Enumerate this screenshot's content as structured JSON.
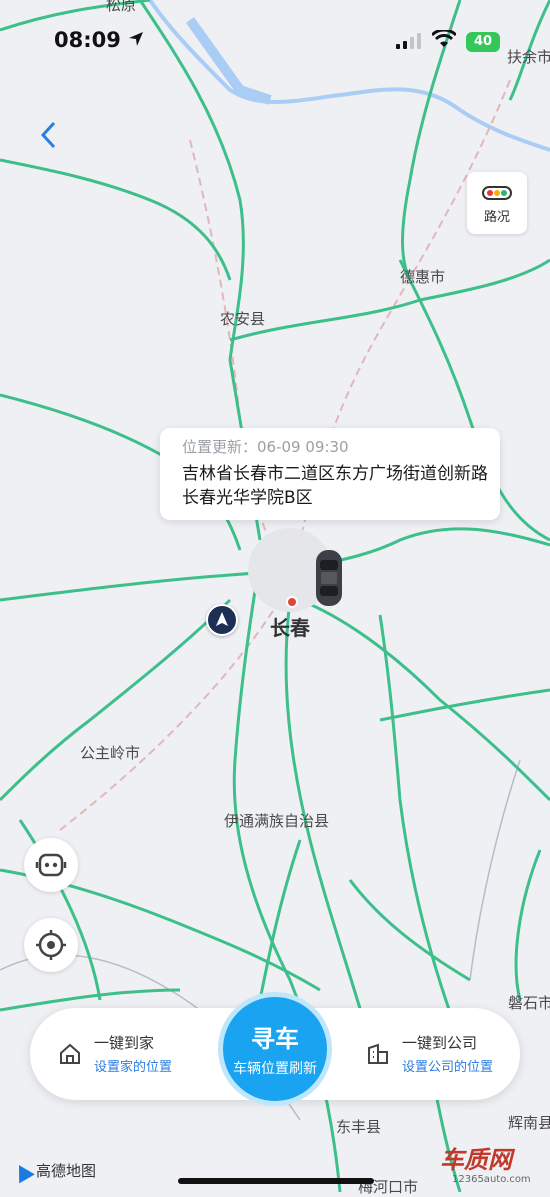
{
  "status": {
    "time": "08:09",
    "battery": "40"
  },
  "map": {
    "places": {
      "songyuan": "松原",
      "fuyu": "扶余市",
      "dehui": "德惠市",
      "nongan": "农安县",
      "changchun": "长春",
      "gongzhuling": "公主岭市",
      "yitong": "伊通满族自治县",
      "panshi": "磐石市",
      "dongfeng": "东丰县",
      "huinan": "辉南县",
      "meihekou": "梅河口市"
    }
  },
  "traffic": {
    "label": "路况"
  },
  "info_card": {
    "updated": "位置更新：06-09 09:30",
    "address": "吉林省长春市二道区东方广场街道创新路长春光华学院B区"
  },
  "quick": {
    "home_title": "一键到家",
    "home_sub": "设置家的位置",
    "work_title": "一键到公司",
    "work_sub": "设置公司的位置"
  },
  "find_car": {
    "title": "寻车",
    "subtitle": "车辆位置刷新"
  },
  "logo": "高德地图",
  "watermark": {
    "main": "车质网",
    "sub": "12365auto.com"
  },
  "colors": {
    "road": "#3dbf8a",
    "accent": "#1aa3f0",
    "link": "#2a7de1"
  }
}
